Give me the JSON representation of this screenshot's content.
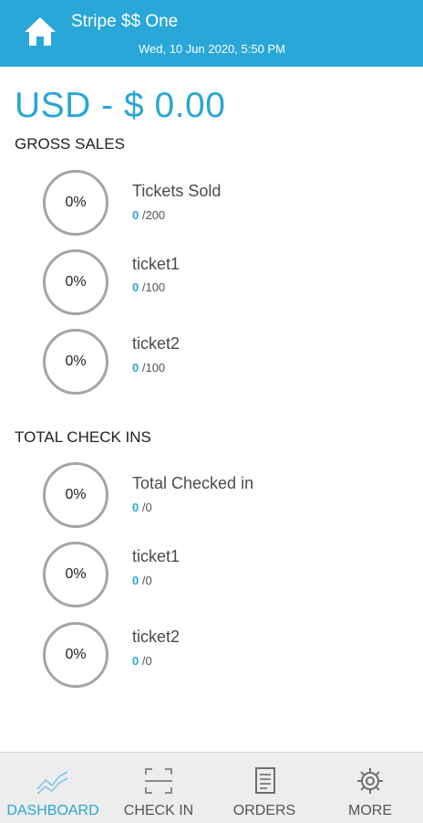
{
  "header": {
    "title": "Stripe $$ One",
    "datetime": "Wed, 10 Jun 2020, 5:50 PM"
  },
  "summary": {
    "amount": "USD - $ 0.00"
  },
  "gross_sales": {
    "heading": "GROSS SALES",
    "items": [
      {
        "percent": "0%",
        "name": "Tickets Sold",
        "current": "0",
        "total": "/200"
      },
      {
        "percent": "0%",
        "name": "ticket1",
        "current": "0",
        "total": "/100"
      },
      {
        "percent": "0%",
        "name": "ticket2",
        "current": "0",
        "total": "/100"
      }
    ]
  },
  "check_ins": {
    "heading": "TOTAL CHECK INS",
    "items": [
      {
        "percent": "0%",
        "name": "Total Checked in",
        "current": "0",
        "total": "/0"
      },
      {
        "percent": "0%",
        "name": "ticket1",
        "current": "0",
        "total": "/0"
      },
      {
        "percent": "0%",
        "name": "ticket2",
        "current": "0",
        "total": "/0"
      }
    ]
  },
  "tabs": [
    {
      "label": "DASHBOARD",
      "icon": "dashboard-chart-icon",
      "active": true
    },
    {
      "label": "CHECK IN",
      "icon": "scan-frame-icon",
      "active": false
    },
    {
      "label": "ORDERS",
      "icon": "receipt-icon",
      "active": false
    },
    {
      "label": "MORE",
      "icon": "gear-icon",
      "active": false
    }
  ],
  "colors": {
    "header_bg": "#29a7d8",
    "accent": "#2aa6d6",
    "ring": "#a5a5a5",
    "tabbar_bg": "#ededed"
  }
}
